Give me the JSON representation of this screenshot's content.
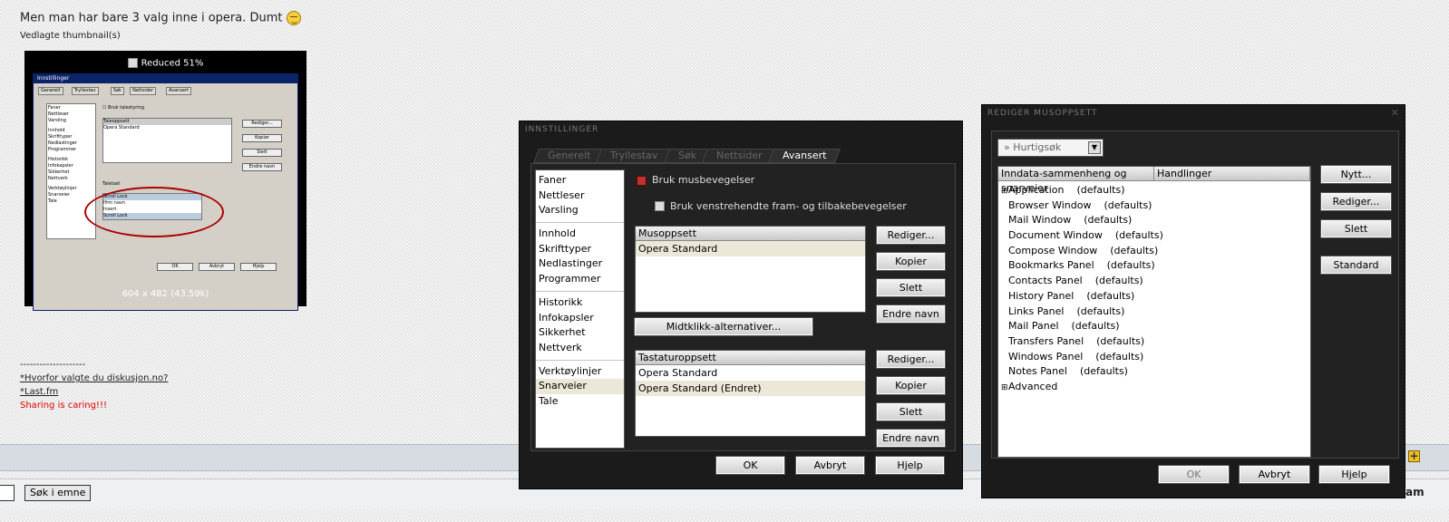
{
  "post": {
    "text": "Men man har bare 3 valg inne i opera. Dumt",
    "attachments_label": "Vedlagte thumbnail(s)"
  },
  "thumbnail": {
    "caption": "Reduced 51%",
    "size": "604 x 482 (43.59k)",
    "mini_title": "Innstillinger",
    "mini_tabs": [
      "Generelt",
      "Tryllestav",
      "Søk",
      "Nettsider",
      "Avansert"
    ],
    "mini_list": [
      "Faner",
      "Nettleser",
      "Varsling",
      "Innhold",
      "Skrifttyper",
      "Nedlastinger",
      "Programmer",
      "Historikk",
      "Infokapsler",
      "Sikkerhet",
      "Nettverk",
      "Verktøylinjer",
      "Snarveier",
      "Tale"
    ],
    "mini_checkbox": "Bruk talestyring",
    "mini_box_header": "Taleoppsett",
    "mini_box_item": "Opera Standard",
    "mini_buttons": [
      "Rediger...",
      "Kopier",
      "Slett",
      "Endre navn"
    ],
    "mini_key_label": "Taletast",
    "mini_dropdown": [
      "Scroll Lock",
      "Ifrm navn",
      "Insert",
      "Scroll Lock"
    ],
    "mini_bottom_buttons": [
      "OK",
      "Avbryt",
      "Hjelp"
    ]
  },
  "signature": {
    "dashes": "--------------------",
    "link1": "*Hvorfor valgte du diskusjon.no?",
    "link2": "*Last.fm",
    "motto": "Sharing is caring!!!"
  },
  "search": {
    "button": "Søk i emne"
  },
  "cut_text": "am",
  "plus_label": "+",
  "innstillinger": {
    "title": "INNSTILLINGER",
    "tabs": [
      "Generelt",
      "Tryllestav",
      "Søk",
      "Nettsider",
      "Avansert"
    ],
    "active_tab": "Avansert",
    "sidebar_groups": [
      [
        "Faner",
        "Nettleser",
        "Varsling"
      ],
      [
        "Innhold",
        "Skrifttyper",
        "Nedlastinger",
        "Programmer"
      ],
      [
        "Historikk",
        "Infokapsler",
        "Sikkerhet",
        "Nettverk"
      ],
      [
        "Verktøylinjer",
        "Snarveier",
        "Tale"
      ]
    ],
    "selected_item": "Snarveier",
    "checkbox_mouse": "Bruk musbevegelser",
    "checkbox_left": "Bruk venstrehendte fram- og tilbakebevegelser",
    "mouse_header": "Musoppsett",
    "mouse_items": [
      "Opera Standard"
    ],
    "middle_click_button": "Midtklikk-alternativer...",
    "keyboard_header": "Tastaturoppsett",
    "keyboard_items": [
      "Opera Standard",
      "Opera Standard (Endret)"
    ],
    "side_buttons": [
      "Rediger...",
      "Kopier",
      "Slett",
      "Endre navn"
    ],
    "ok": "OK",
    "cancel": "Avbryt",
    "help": "Hjelp"
  },
  "musoppsett": {
    "title": "REDIGER MUSOPPSETT",
    "quicksearch": "Hurtigsøk",
    "col1": "Inndata-sammenheng og snarveier",
    "col2": "Handlinger",
    "tree": [
      {
        "name": "Application",
        "tag": "(defaults)",
        "expandable": "⊞"
      },
      {
        "name": "Browser Window",
        "tag": "(defaults)"
      },
      {
        "name": "Mail Window",
        "tag": "(defaults)"
      },
      {
        "name": "Document Window",
        "tag": "(defaults)"
      },
      {
        "name": "Compose Window",
        "tag": "(defaults)"
      },
      {
        "name": "Bookmarks Panel",
        "tag": "(defaults)"
      },
      {
        "name": "Contacts Panel",
        "tag": "(defaults)"
      },
      {
        "name": "History Panel",
        "tag": "(defaults)"
      },
      {
        "name": "Links Panel",
        "tag": "(defaults)"
      },
      {
        "name": "Mail Panel",
        "tag": "(defaults)"
      },
      {
        "name": "Transfers Panel",
        "tag": "(defaults)"
      },
      {
        "name": "Windows Panel",
        "tag": "(defaults)"
      },
      {
        "name": "Notes Panel",
        "tag": "(defaults)"
      },
      {
        "name": "Advanced",
        "tag": "",
        "expandable": "⊞"
      }
    ],
    "buttons": [
      "Nytt...",
      "Rediger...",
      "Slett",
      "Standard"
    ],
    "ok": "OK",
    "cancel": "Avbryt",
    "help": "Hjelp"
  }
}
